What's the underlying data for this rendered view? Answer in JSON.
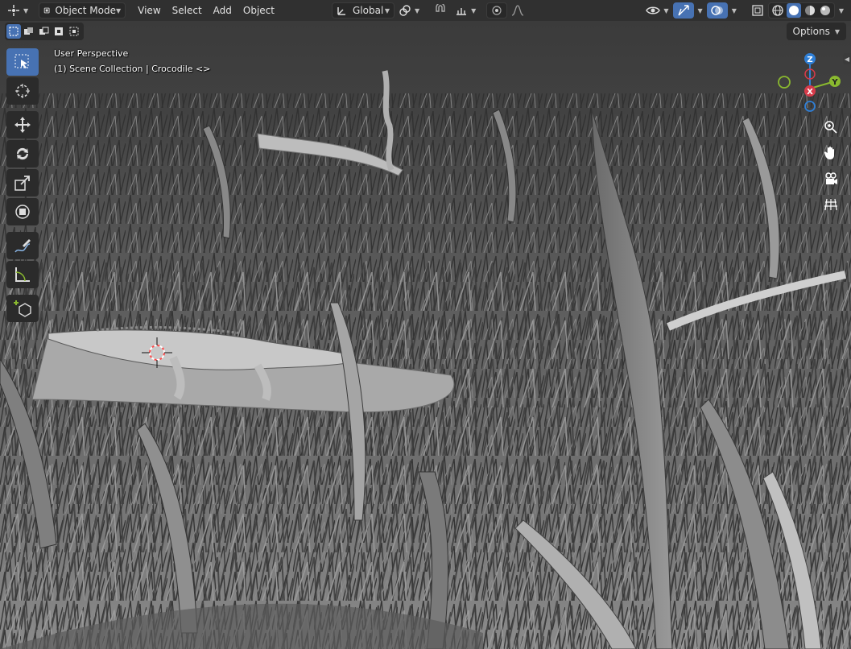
{
  "header": {
    "editor_type_icon": "3d-viewport-icon",
    "mode": {
      "icon": "object-mode-icon",
      "label": "Object Mode"
    },
    "menus": [
      "View",
      "Select",
      "Add",
      "Object"
    ],
    "transform_orientation": {
      "icon": "orientation-icon",
      "label": "Global"
    },
    "pivot_icon": "pivot-icon",
    "snap_icon": "magnet-icon",
    "snap_target_icon": "snap-increment-icon",
    "proportional_icon": "proportional-edit-icon",
    "falloff_icon": "falloff-curve-icon",
    "visibility_icon": "eye-icon",
    "gizmo_icon": "gizmo-icon",
    "overlay_icon": "overlay-icon",
    "xray_icon": "xray-icon",
    "shading_icons": [
      "wireframe-shading-icon",
      "solid-shading-icon",
      "material-preview-icon",
      "rendered-shading-icon"
    ],
    "shading_active": "solid"
  },
  "viewport": {
    "select_modes": [
      "select-new-icon",
      "select-extend-icon",
      "select-subtract-icon",
      "select-invert-icon",
      "select-intersect-icon"
    ],
    "perspective_label": "User Perspective",
    "collection_label": "(1) Scene Collection | Crocodile <>",
    "options_label": "Options",
    "tools": [
      {
        "name": "select-box-icon",
        "active": true
      },
      {
        "name": "cursor-icon",
        "active": false
      },
      {
        "name": "move-icon",
        "active": false
      },
      {
        "name": "rotate-icon",
        "active": false
      },
      {
        "name": "scale-icon",
        "active": false
      },
      {
        "name": "transform-icon",
        "active": false
      },
      {
        "name": "annotate-icon",
        "active": false
      },
      {
        "name": "measure-icon",
        "active": false
      },
      {
        "name": "add-cube-icon",
        "active": false
      }
    ],
    "gizmo": {
      "z": "Z",
      "y": "Y",
      "x": "X"
    },
    "nav_buttons": [
      "zoom-icon",
      "pan-hand-icon",
      "camera-view-icon",
      "ortho-grid-icon"
    ],
    "colors": {
      "accent": "#4772b3",
      "x_axis": "#d63b4a",
      "y_axis": "#8ab92f",
      "z_axis": "#2f7fd6"
    }
  }
}
